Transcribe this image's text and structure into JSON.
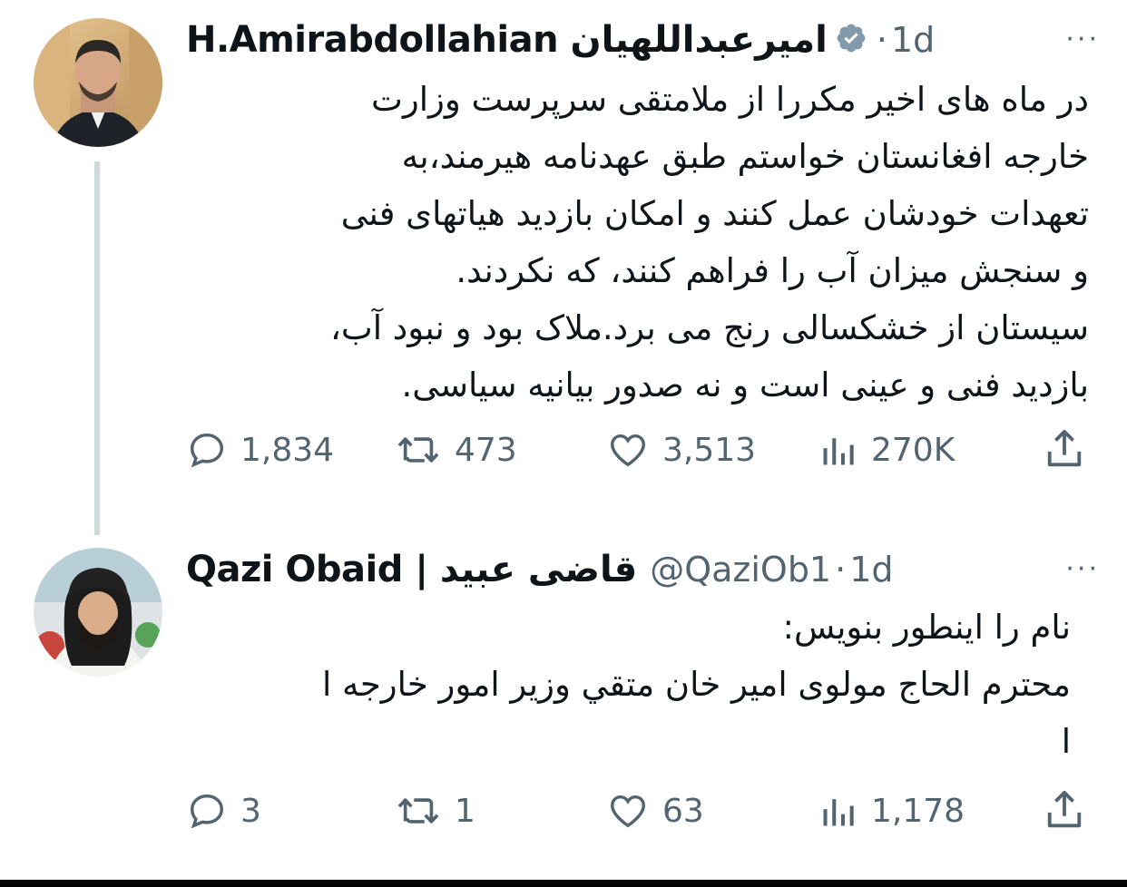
{
  "tweets": [
    {
      "display_name": "H.Amirabdollahian امیرعبداللهیان",
      "handle": "",
      "verified": true,
      "separator": "·",
      "time": "1d",
      "more": "···",
      "lines": [
        "در ماه های اخیر مکررا از ملامتقی سرپرست وزارت",
        "خارجه افغانستان خواستم طبق عهدنامه هیرمند،به",
        "تعهدات خودشان عمل کنند و امکان بازدید هیاتهای فنی",
        "و سنجش میزان آب را فراهم کنند، که نکردند.",
        "سیستان از خشکسالی رنج می برد.ملاک بود و نبود آب،",
        "بازدید فنی و عینی است و نه صدور بیانیه سیاسی."
      ],
      "stats": {
        "replies": "1,834",
        "retweets": "473",
        "likes": "3,513",
        "views": "270K"
      }
    },
    {
      "display_name": "Qazi Obaid | قاضی عبید",
      "handle": "@QaziOb1",
      "verified": false,
      "separator": "·",
      "time": "1d",
      "more": "···",
      "lines": [
        "نام را اینطور بنویس:",
        "محترم الحاج مولوی امیر خان متقي وزیر امور خارجه ا",
        "ا"
      ],
      "stats": {
        "replies": "3",
        "retweets": "1",
        "likes": "63",
        "views": "1,178"
      }
    }
  ],
  "colors": {
    "text": "#0f1419",
    "muted": "#536471",
    "verified": "#829aab",
    "thread": "#cfd9de"
  },
  "icons": [
    "reply-icon",
    "retweet-icon",
    "like-icon",
    "views-icon",
    "share-icon",
    "verified-badge-icon"
  ]
}
